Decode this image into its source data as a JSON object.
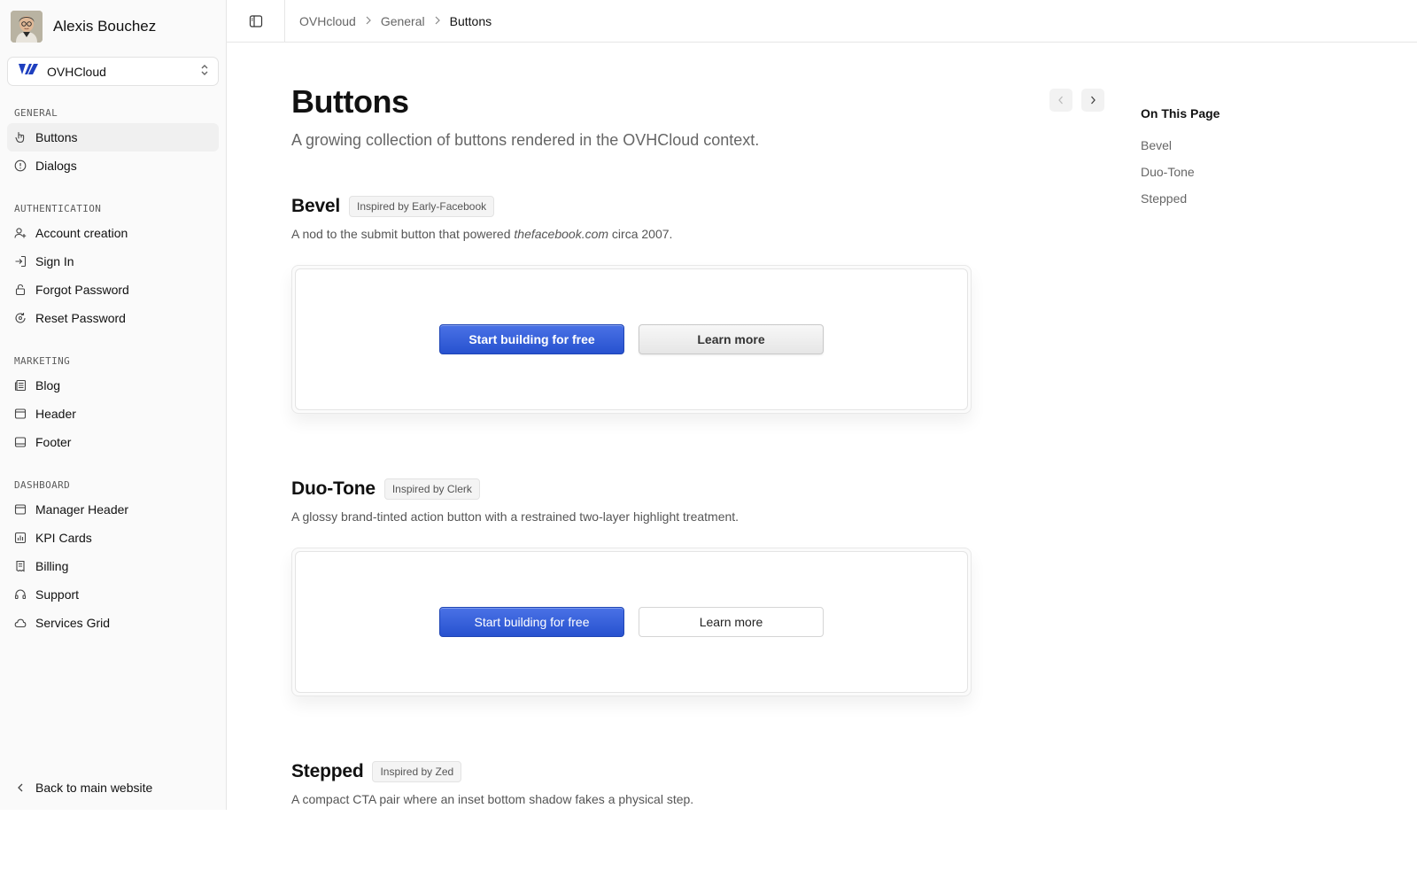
{
  "user": {
    "name": "Alexis Bouchez"
  },
  "org": {
    "name": "OVHCloud"
  },
  "nav": {
    "sections": [
      {
        "label": "General",
        "items": [
          {
            "label": "Buttons",
            "icon": "pointer-icon"
          },
          {
            "label": "Dialogs",
            "icon": "alert-circle-icon"
          }
        ]
      },
      {
        "label": "Authentication",
        "items": [
          {
            "label": "Account creation",
            "icon": "user-plus-icon"
          },
          {
            "label": "Sign In",
            "icon": "log-in-icon"
          },
          {
            "label": "Forgot Password",
            "icon": "lock-icon"
          },
          {
            "label": "Reset Password",
            "icon": "reset-icon"
          }
        ]
      },
      {
        "label": "Marketing",
        "items": [
          {
            "label": "Blog",
            "icon": "newspaper-icon"
          },
          {
            "label": "Header",
            "icon": "layout-header-icon"
          },
          {
            "label": "Footer",
            "icon": "layout-footer-icon"
          }
        ]
      },
      {
        "label": "Dashboard",
        "items": [
          {
            "label": "Manager Header",
            "icon": "layout-header-icon"
          },
          {
            "label": "KPI Cards",
            "icon": "bar-chart-icon"
          },
          {
            "label": "Billing",
            "icon": "receipt-icon"
          },
          {
            "label": "Support",
            "icon": "headset-icon"
          },
          {
            "label": "Services Grid",
            "icon": "cloud-icon"
          }
        ]
      }
    ],
    "active": "Buttons",
    "back_label": "Back to main website"
  },
  "breadcrumb": [
    "OVHcloud",
    "General",
    "Buttons"
  ],
  "page": {
    "title": "Buttons",
    "subtitle": "A growing collection of buttons rendered in the OVHCloud context."
  },
  "sections": [
    {
      "title": "Bevel",
      "badge": "Inspired by Early-Facebook",
      "desc_before": "A nod to the submit button that powered ",
      "desc_em": "thefacebook.com",
      "desc_after": " circa 2007.",
      "primary_label": "Start building for free",
      "secondary_label": "Learn more"
    },
    {
      "title": "Duo-Tone",
      "badge": "Inspired by Clerk",
      "desc": "A glossy brand-tinted action button with a restrained two-layer highlight treatment.",
      "primary_label": "Start building for free",
      "secondary_label": "Learn more"
    },
    {
      "title": "Stepped",
      "badge": "Inspired by Zed",
      "desc": "A compact CTA pair where an inset bottom shadow fakes a physical step."
    }
  ],
  "toc": {
    "title": "On This Page",
    "items": [
      "Bevel",
      "Duo-Tone",
      "Stepped"
    ]
  },
  "colors": {
    "brand": "#2752cf",
    "sidebar_bg": "#fafafa",
    "logo_blue": "#1e3fbf"
  }
}
